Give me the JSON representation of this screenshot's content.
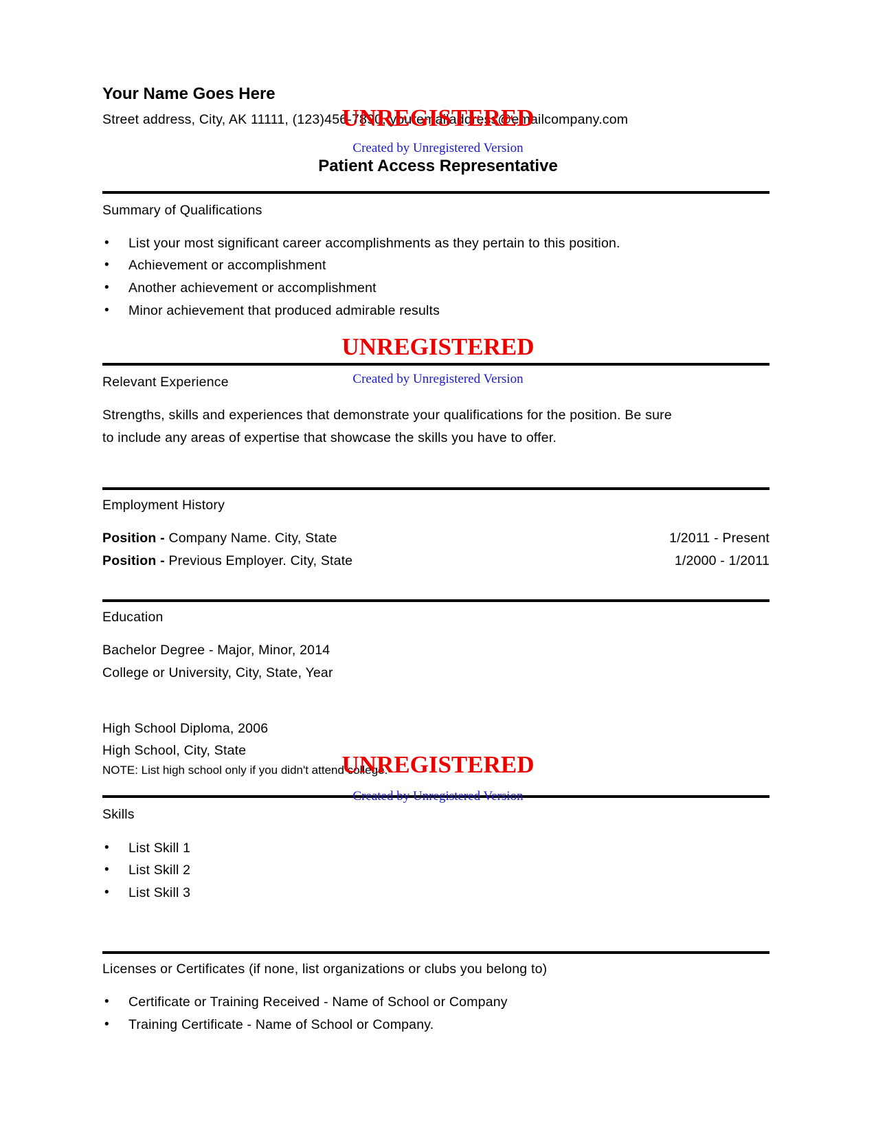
{
  "header": {
    "name": "Your Name Goes Here",
    "contact": "Street address, City, AK 11111, (123)456-7890, youremailaddress@emailcompany.com",
    "title": "Patient Access Representative"
  },
  "watermarks": {
    "main": "UNREGISTERED",
    "sub": "Created by Unregistered Version",
    "colors": {
      "main": "#ee0000",
      "sub": "#1a1acc"
    }
  },
  "summary": {
    "heading": "Summary of Qualifications",
    "items": [
      "List your most significant career accomplishments as they pertain to this position.",
      "Achievement or accomplishment",
      "Another achievement or accomplishment",
      "Minor achievement that produced admirable results"
    ]
  },
  "experience": {
    "heading": "Relevant Experience",
    "lines": [
      "Strengths, skills and experiences that demonstrate your qualifications for the position. Be sure",
      "to include any areas of expertise that showcase the skills you have to offer."
    ]
  },
  "employment": {
    "heading": "Employment History",
    "jobs": [
      {
        "position": "Position -",
        "employer": " Company Name. City, State",
        "dates": "1/2011 - Present"
      },
      {
        "position": "Position -",
        "employer": " Previous Employer. City, State",
        "dates": "1/2000 - 1/2011"
      }
    ]
  },
  "education": {
    "heading": "Education",
    "degree": "Bachelor Degree - Major, Minor, 2014",
    "college": "College or University, City, State, Year",
    "diploma": "High School Diploma, 2006",
    "high_school": "High School, City, State",
    "note": "NOTE: List high school only if you didn't attend college."
  },
  "skills": {
    "heading": "Skills",
    "items": [
      "List Skill 1",
      "List Skill 2",
      "List Skill 3"
    ]
  },
  "licenses": {
    "heading": "Licenses or Certificates (if none, list organizations or clubs you belong to)",
    "items": [
      "Certificate or Training Received - Name of School or Company",
      "Training Certificate - Name of School or Company."
    ]
  },
  "bullet_glyph": "•"
}
